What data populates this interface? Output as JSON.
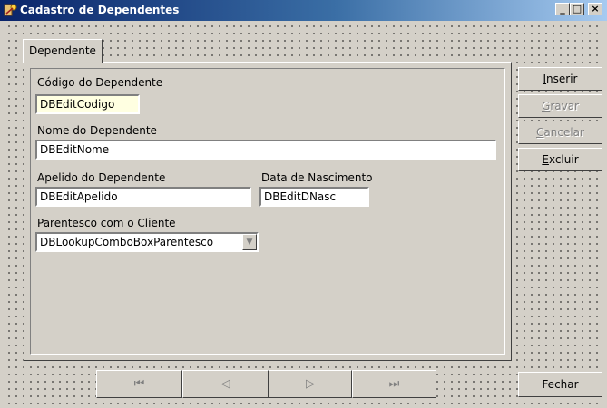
{
  "window": {
    "title": "Cadastro de Dependentes",
    "controls": {
      "minimize": "_",
      "maximize": "□",
      "close": "×"
    }
  },
  "tab": {
    "label": "Dependente"
  },
  "fields": {
    "codigo": {
      "label": "Código do Dependente",
      "value": "DBEditCodigo"
    },
    "nome": {
      "label": "Nome do Dependente",
      "value": "DBEditNome"
    },
    "apelido": {
      "label": "Apelido do Dependente",
      "value": "DBEditApelido"
    },
    "nascimento": {
      "label": "Data de Nascimento",
      "value": "DBEditDNasc"
    },
    "parentesco": {
      "label": "Parentesco com o Cliente",
      "value": "DBLookupComboBoxParentesco"
    }
  },
  "buttons": {
    "inserir": {
      "pre": "",
      "key": "I",
      "post": "nserir"
    },
    "gravar": {
      "pre": "",
      "key": "G",
      "post": "ravar"
    },
    "cancelar": {
      "pre": "",
      "key": "C",
      "post": "ancelar"
    },
    "excluir": {
      "pre": "",
      "key": "E",
      "post": "xcluir"
    },
    "fechar": "Fechar"
  },
  "navigator": {
    "first": "⏮",
    "prior": "◁",
    "next": "▷",
    "last": "⏭"
  }
}
